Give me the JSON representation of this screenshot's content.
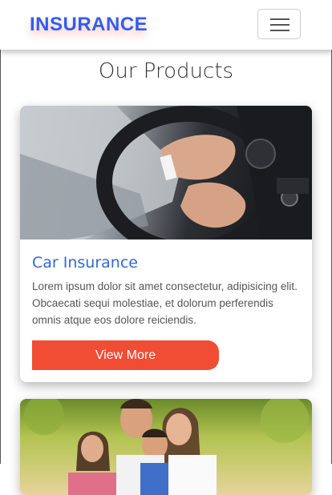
{
  "navbar": {
    "brand": "INSURANCE",
    "toggle_icon": "hamburger-icon"
  },
  "section": {
    "title": "Our Products"
  },
  "cards": [
    {
      "title": "Car Insurance",
      "text": "Lorem ipsum dolor sit amet consectetur, adipisicing elit. Obcaecati sequi molestiae, et dolorum perferendis omnis atque eos dolore reiciendis.",
      "button": "View More"
    }
  ],
  "colors": {
    "brand": "#2f5ef0",
    "accent": "#f04d34",
    "card_title": "#2f68e0"
  }
}
